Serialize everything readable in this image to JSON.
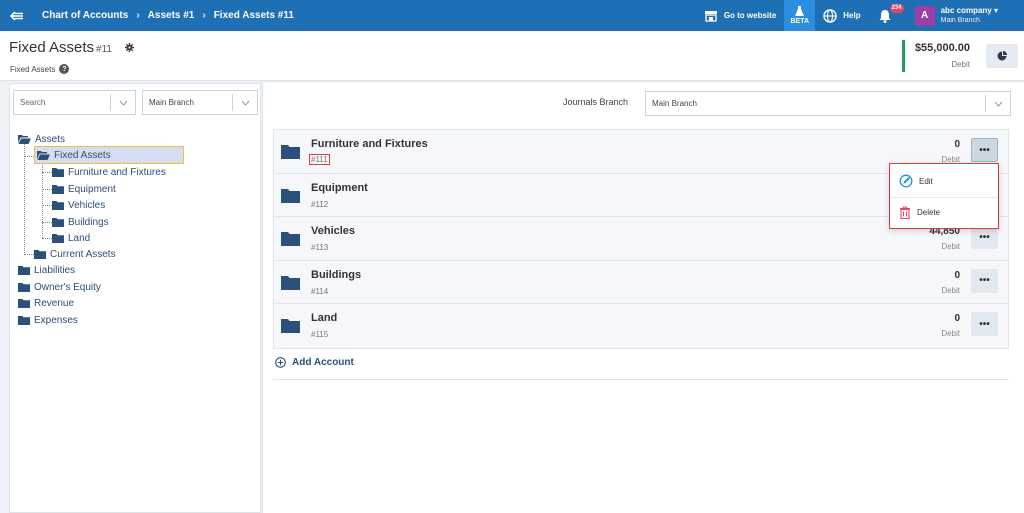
{
  "topbar": {
    "breadcrumbs": [
      "Chart of Accounts",
      "Assets #1",
      "Fixed Assets #11"
    ],
    "go_to_website": "Go to website",
    "beta": "BETA",
    "help": "Help",
    "notifications_count": "234",
    "avatar_letter": "A",
    "company_name": "abc company",
    "branch": "Main Branch"
  },
  "header": {
    "title": "Fixed Assets",
    "title_number": "#11",
    "subtitle": "Fixed Assets",
    "balance_amount": "$55,000.00",
    "balance_label": "Debit"
  },
  "left_panel": {
    "search_placeholder": "Search",
    "branch_value": "Main Branch",
    "tree": {
      "assets": "Assets",
      "fixed_assets": "Fixed Assets",
      "furniture": "Furniture and Fixtures",
      "equipment": "Equipment",
      "vehicles": "Vehicles",
      "buildings": "Buildings",
      "land": "Land",
      "current_assets": "Current Assets",
      "liabilities": "Liabilities",
      "owners_equity": "Owner's Equity",
      "revenue": "Revenue",
      "expenses": "Expenses"
    }
  },
  "right_panel": {
    "journals_branch_label": "Journals Branch",
    "journals_branch_value": "Main Branch",
    "accounts": [
      {
        "name": "Furniture and Fixtures",
        "code": "#111",
        "value": "0",
        "label": "Debit"
      },
      {
        "name": "Equipment",
        "code": "#112",
        "value": "",
        "label": ""
      },
      {
        "name": "Vehicles",
        "code": "#113",
        "value": "44,850",
        "label": "Debit"
      },
      {
        "name": "Buildings",
        "code": "#114",
        "value": "0",
        "label": "Debit"
      },
      {
        "name": "Land",
        "code": "#115",
        "value": "0",
        "label": "Debit"
      }
    ],
    "more_label": "•••",
    "add_account": "Add Account"
  },
  "dropdown": {
    "edit": "Edit",
    "delete": "Delete"
  },
  "colors": {
    "primary": "#1f6fb5",
    "folder": "#2b5079",
    "debit_bar": "#1e9e5a",
    "highlight": "#e03a3a"
  }
}
